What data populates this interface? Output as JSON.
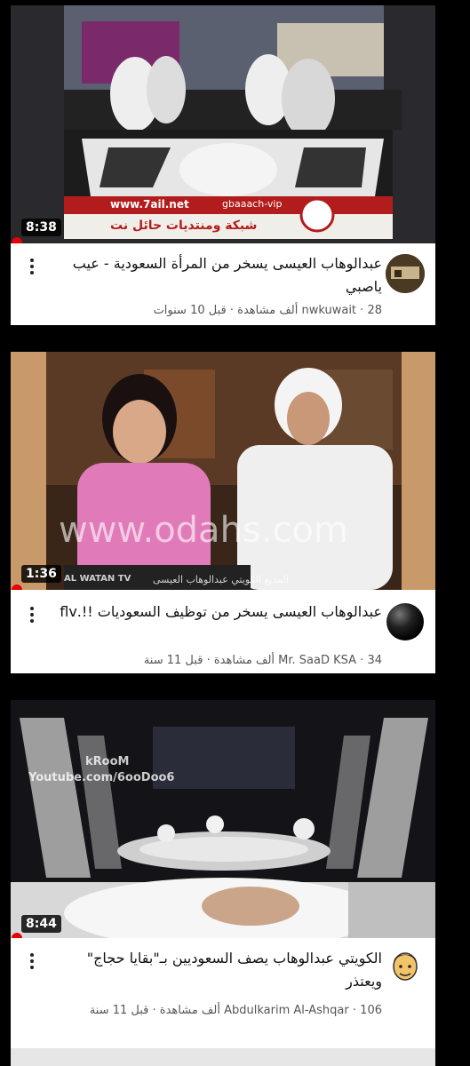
{
  "videos": [
    {
      "duration": "8:38",
      "title": "عبدالوهاب العيسى يسخر من المرأة السعودية - عيب ياصبي",
      "channel": "nwkuwait",
      "views": "28 ألف مشاهدة",
      "age": "قبل 10 سنوات",
      "thumb_text": {
        "url": "www.7ail.net",
        "handle": "gbaaach-vip",
        "caption": "شبكة ومنتديات حائل نت"
      }
    },
    {
      "duration": "1:36",
      "title": "عبدالوهاب العيسى يسخر من توظيف السعوديات !!.flv",
      "channel": "Mr. SaaD KSA",
      "views": "34 ألف مشاهدة",
      "age": "قبل 11 سنة",
      "thumb_text": {
        "watermark": "www.odahs.com",
        "network": "AL WATAN TV",
        "caption": "المذيع الكويتي عبدالوهاب العيسى"
      }
    },
    {
      "duration": "8:44",
      "title": "الكويتي عبدالوهاب يصف السعوديين بـ\"بقايا حجاج\" ويعتذر",
      "channel": "Abdulkarim Al-Ashqar",
      "views": "106 ألف مشاهدة",
      "age": "قبل 11 سنة",
      "thumb_text": {
        "line1": "kRooM",
        "line2": "Youtube.com/6ooDoo6"
      }
    }
  ],
  "separator": "·",
  "colors": {
    "accent": "#e60000",
    "title": "#111111",
    "meta": "#555555"
  },
  "icons": {
    "more": "kebab-menu-icon",
    "avatar": "channel-avatar"
  }
}
